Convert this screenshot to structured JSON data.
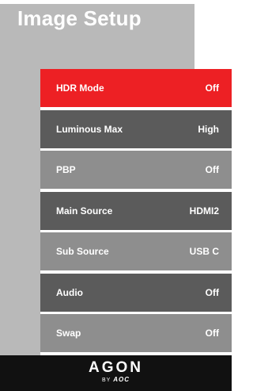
{
  "page": {
    "title": "Image Setup"
  },
  "menu": {
    "items": [
      {
        "label": "HDR Mode",
        "value": "Off",
        "selected": true,
        "bg": "#ed2024"
      },
      {
        "label": "Luminous Max",
        "value": "High",
        "bg": "#5b5b5b"
      },
      {
        "label": "PBP",
        "value": "Off",
        "bg": "#8e8e8e"
      },
      {
        "label": "Main Source",
        "value": "HDMI2",
        "bg": "#5b5b5b"
      },
      {
        "label": "Sub Source",
        "value": "USB C",
        "bg": "#8e8e8e"
      },
      {
        "label": "Audio",
        "value": "Off",
        "bg": "#5b5b5b"
      },
      {
        "label": "Swap",
        "value": "Off",
        "bg": "#8e8e8e"
      }
    ]
  },
  "footer": {
    "logo_main": "AGON",
    "logo_by": "BY",
    "logo_brand": "AOC"
  }
}
